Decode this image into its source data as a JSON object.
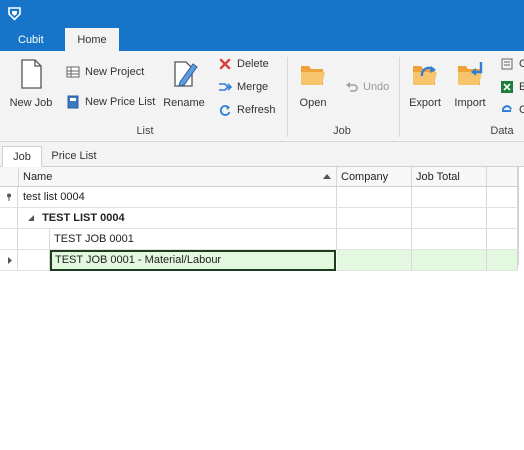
{
  "app": {
    "logo_icon": "cubit-logo-icon",
    "tabs": [
      "Cubit",
      "Home"
    ],
    "active_tab": "Home"
  },
  "ribbon": {
    "list_group": {
      "label": "List",
      "new_job": "New Job",
      "new_project": "New Project",
      "new_price_list": "New Price List",
      "rename": "Rename",
      "delete": "Delete",
      "merge": "Merge",
      "refresh": "Refresh"
    },
    "job_group": {
      "label": "Job",
      "open": "Open",
      "undo": "Undo"
    },
    "data_group": {
      "label": "Data",
      "export": "Export",
      "import": "Import",
      "overflow_items": [
        "C",
        "E",
        "C"
      ]
    }
  },
  "doc_tabs": [
    "Job",
    "Price List"
  ],
  "grid": {
    "columns": [
      "Name",
      "Company",
      "Job Total"
    ],
    "filter_value": "test list 0004",
    "rows": [
      {
        "name": "TEST LIST 0004",
        "company": "",
        "job_total": "",
        "level": 0,
        "expanded": true
      },
      {
        "name": "TEST JOB 0001",
        "company": "",
        "job_total": "",
        "level": 1
      },
      {
        "name": "TEST JOB 0001 - Material/Labour",
        "company": "",
        "job_total": "",
        "level": 1,
        "selected": true
      }
    ]
  },
  "colors": {
    "accent": "#1675c9",
    "ribbon_bg": "#f3f3f3",
    "selected_row": "#e2f8df",
    "delete_red": "#d64545",
    "folder_orange": "#f0a23a",
    "refresh_blue": "#2f7fd6"
  }
}
